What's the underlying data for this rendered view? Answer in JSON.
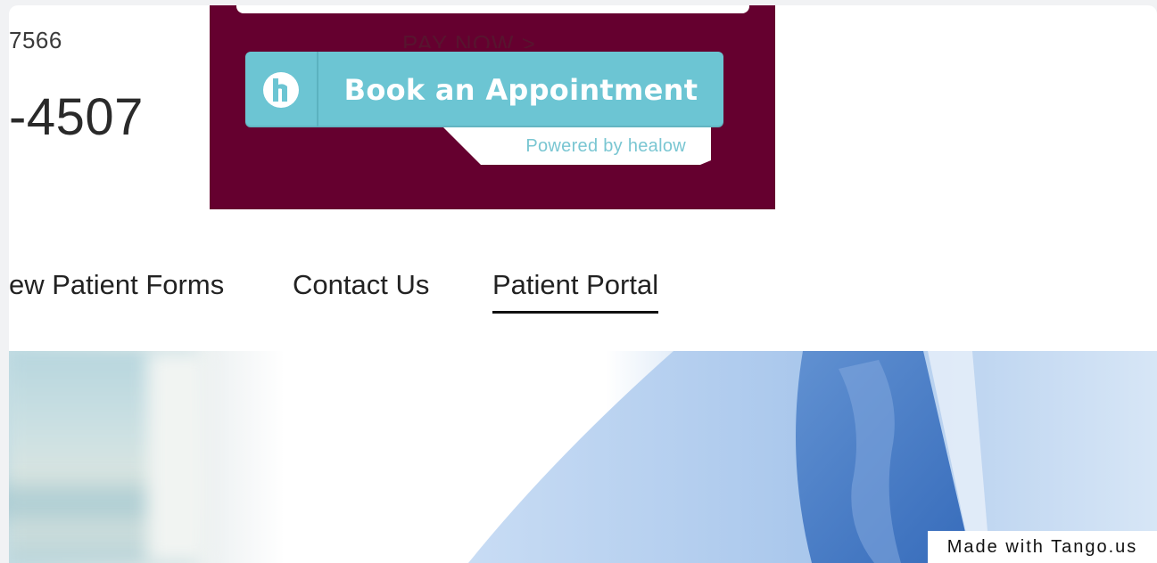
{
  "header": {
    "phone_partial_top": "7566",
    "phone_partial_big": "-4507",
    "pay_now_partial": "PAY NOW >"
  },
  "booking": {
    "button_label": "Book an Appointment",
    "powered_by": "Powered by healow",
    "logo_icon": "healow-h-icon",
    "colors": {
      "banner_bg": "#65002f",
      "button_bg": "#6cc5d3",
      "powered_text": "#79c6d2"
    }
  },
  "nav": {
    "items": [
      {
        "label": "ew Patient Forms"
      },
      {
        "label": "Contact Us"
      },
      {
        "label": "Patient Portal",
        "active": true
      }
    ]
  },
  "watermark": {
    "label": "Made with Tango.us"
  }
}
